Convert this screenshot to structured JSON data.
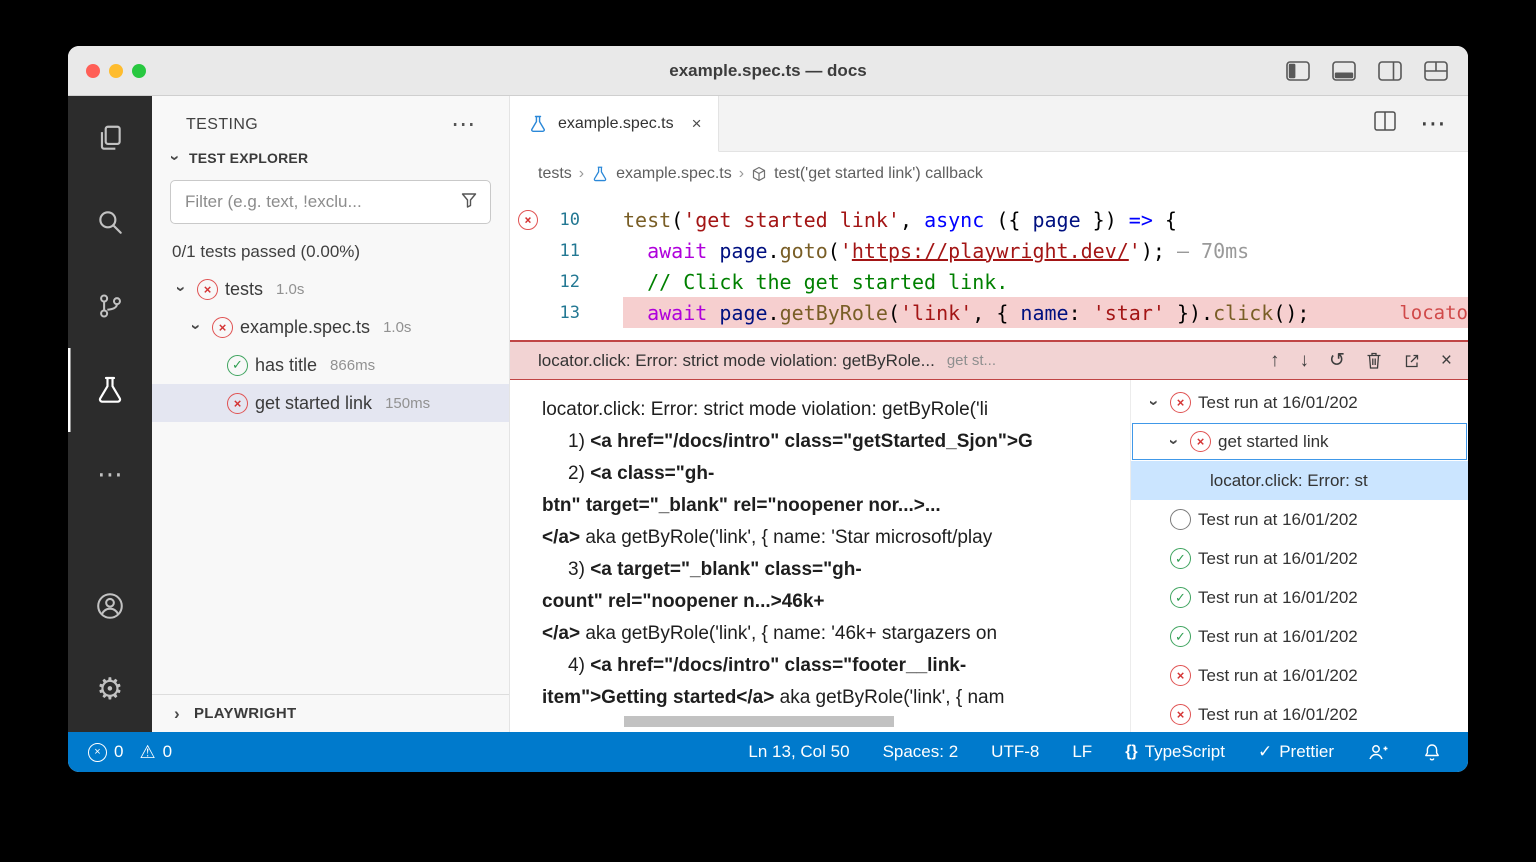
{
  "window": {
    "title": "example.spec.ts — docs"
  },
  "sidebar": {
    "title": "TESTING",
    "explorer_header": "TEST EXPLORER",
    "filter_placeholder": "Filter (e.g. text, !exclu...",
    "summary": "0/1 tests passed (0.00%)",
    "tree": [
      {
        "label": "tests",
        "duration": "1.0s",
        "status": "error",
        "indent": 0,
        "chevron": true
      },
      {
        "label": "example.spec.ts",
        "duration": "1.0s",
        "status": "error",
        "indent": 1,
        "chevron": true
      },
      {
        "label": "has title",
        "duration": "866ms",
        "status": "pass",
        "indent": 2,
        "chevron": false
      },
      {
        "label": "get started link",
        "duration": "150ms",
        "status": "error",
        "indent": 2,
        "chevron": false,
        "selected": true
      }
    ],
    "playwright_header": "PLAYWRIGHT"
  },
  "editor": {
    "tab_label": "example.spec.ts",
    "breadcrumbs": [
      "tests",
      "example.spec.ts",
      "test('get started link') callback"
    ],
    "lines": [
      {
        "num": "10",
        "gutter_error": true,
        "error_line": false,
        "tokens": [
          {
            "t": "test",
            "c": "fn"
          },
          {
            "t": "(",
            "c": "pl"
          },
          {
            "t": "'get started link'",
            "c": "str"
          },
          {
            "t": ", ",
            "c": "pl"
          },
          {
            "t": "async",
            "c": "kwb"
          },
          {
            "t": " ({ ",
            "c": "pl"
          },
          {
            "t": "page",
            "c": "var"
          },
          {
            "t": " }) ",
            "c": "pl"
          },
          {
            "t": "=>",
            "c": "kwb"
          },
          {
            "t": " {",
            "c": "pl"
          }
        ]
      },
      {
        "num": "11",
        "gutter_error": false,
        "error_line": false,
        "tokens": [
          {
            "t": "  ",
            "c": "pl"
          },
          {
            "t": "await",
            "c": "kw"
          },
          {
            "t": " ",
            "c": "pl"
          },
          {
            "t": "page",
            "c": "var"
          },
          {
            "t": ".",
            "c": "pl"
          },
          {
            "t": "goto",
            "c": "fn"
          },
          {
            "t": "(",
            "c": "pl"
          },
          {
            "t": "'",
            "c": "str"
          },
          {
            "t": "https://playwright.dev/",
            "c": "strlink"
          },
          {
            "t": "'",
            "c": "str"
          },
          {
            "t": ");",
            "c": "pl"
          },
          {
            "t": " — 70ms",
            "c": "decor"
          }
        ]
      },
      {
        "num": "12",
        "gutter_error": false,
        "error_line": false,
        "tokens": [
          {
            "t": "  ",
            "c": "pl"
          },
          {
            "t": "// Click the get started link.",
            "c": "cm"
          }
        ]
      },
      {
        "num": "13",
        "gutter_error": false,
        "error_line": true,
        "inline_error": "locato",
        "tokens": [
          {
            "t": "  ",
            "c": "pl"
          },
          {
            "t": "await",
            "c": "kw"
          },
          {
            "t": " ",
            "c": "pl"
          },
          {
            "t": "page",
            "c": "var"
          },
          {
            "t": ".",
            "c": "pl"
          },
          {
            "t": "getByRole",
            "c": "fn"
          },
          {
            "t": "(",
            "c": "pl"
          },
          {
            "t": "'link'",
            "c": "str"
          },
          {
            "t": ", { ",
            "c": "pl"
          },
          {
            "t": "name",
            "c": "var"
          },
          {
            "t": ": ",
            "c": "pl"
          },
          {
            "t": "'star'",
            "c": "str"
          },
          {
            "t": " }).",
            "c": "pl"
          },
          {
            "t": "click",
            "c": "fn"
          },
          {
            "t": "();",
            "c": "pl"
          }
        ]
      }
    ]
  },
  "peek": {
    "title": "locator.click: Error: strict mode violation: getByRole...",
    "meta": "get st...",
    "message": [
      {
        "indent": false,
        "segs": [
          {
            "t": "locator.click: Error: strict mode violation: getByRole('li",
            "b": false
          }
        ]
      },
      {
        "indent": true,
        "segs": [
          {
            "t": "1) ",
            "b": false
          },
          {
            "t": "<a href=\"/docs/intro\" class=\"getStarted_Sjon\">G",
            "b": true
          }
        ]
      },
      {
        "indent": true,
        "segs": [
          {
            "t": "2) ",
            "b": false
          },
          {
            "t": "<a class=\"gh-",
            "b": true
          }
        ]
      },
      {
        "indent": false,
        "segs": [
          {
            "t": "btn\" target=\"_blank\" rel=\"noopener nor...>...",
            "b": true
          }
        ]
      },
      {
        "indent": false,
        "segs": [
          {
            "t": "</a>",
            "b": true
          },
          {
            "t": " aka getByRole('link', { name: 'Star microsoft/play",
            "b": false
          }
        ]
      },
      {
        "indent": true,
        "segs": [
          {
            "t": "3) ",
            "b": false
          },
          {
            "t": "<a target=\"_blank\" class=\"gh-",
            "b": true
          }
        ]
      },
      {
        "indent": false,
        "segs": [
          {
            "t": "count\" rel=\"noopener n...>46k+",
            "b": true
          }
        ]
      },
      {
        "indent": false,
        "segs": [
          {
            "t": "</a>",
            "b": true
          },
          {
            "t": " aka getByRole('link', { name: '46k+ stargazers on",
            "b": false
          }
        ]
      },
      {
        "indent": true,
        "segs": [
          {
            "t": "4) ",
            "b": false
          },
          {
            "t": "<a href=\"/docs/intro\" class=\"footer__link-",
            "b": true
          }
        ]
      },
      {
        "indent": false,
        "segs": [
          {
            "t": "item\">Getting started</a>",
            "b": true
          },
          {
            "t": " aka getByRole('link', { nam",
            "b": false
          }
        ]
      }
    ],
    "results": [
      {
        "label": "Test run at 16/01/202",
        "status": "error",
        "chevron": true,
        "indent": 0
      },
      {
        "label": "get started link",
        "status": "error",
        "chevron": true,
        "indent": 1,
        "focused": true
      },
      {
        "label": "locator.click: Error: st",
        "status": "none",
        "chevron": false,
        "indent": 2,
        "selected": true
      },
      {
        "label": "Test run at 16/01/202",
        "status": "empty",
        "chevron": false,
        "indent": 0
      },
      {
        "label": "Test run at 16/01/202",
        "status": "pass",
        "chevron": false,
        "indent": 0
      },
      {
        "label": "Test run at 16/01/202",
        "status": "pass",
        "chevron": false,
        "indent": 0
      },
      {
        "label": "Test run at 16/01/202",
        "status": "pass",
        "chevron": false,
        "indent": 0
      },
      {
        "label": "Test run at 16/01/202",
        "status": "error",
        "chevron": false,
        "indent": 0
      },
      {
        "label": "Test run at 16/01/202",
        "status": "error",
        "chevron": false,
        "indent": 0
      }
    ]
  },
  "status_bar": {
    "errors": "0",
    "warnings": "0",
    "cursor": "Ln 13, Col 50",
    "spaces": "Spaces: 2",
    "encoding": "UTF-8",
    "eol": "LF",
    "language": "TypeScript",
    "formatter": "Prettier"
  }
}
